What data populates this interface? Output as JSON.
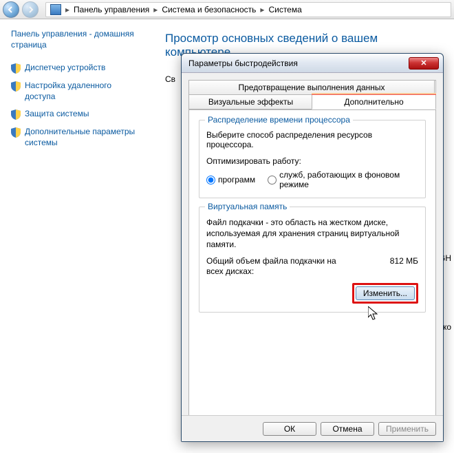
{
  "breadcrumb": {
    "items": [
      "Панель управления",
      "Система и безопасность",
      "Система"
    ]
  },
  "sidebar": {
    "home": "Панель управления - домашняя страница",
    "links": [
      "Диспетчер устройств",
      "Настройка удаленного доступа",
      "Защита системы",
      "Дополнительные параметры системы"
    ]
  },
  "page": {
    "title": "Просмотр основных сведений о вашем компьютере",
    "frag_left": "Св",
    "frag_gh": "GH",
    "frag_ko": "ко"
  },
  "dialog": {
    "title": "Параметры быстродействия",
    "tabs": {
      "dep": "Предотвращение выполнения данных",
      "visual": "Визуальные эффекты",
      "advanced": "Дополнительно"
    },
    "cpu": {
      "group_title": "Распределение времени процессора",
      "desc": "Выберите способ распределения ресурсов процессора.",
      "optimize_label": "Оптимизировать работу:",
      "opt_programs": "программ",
      "opt_services": "служб, работающих в фоновом режиме"
    },
    "vm": {
      "group_title": "Виртуальная память",
      "desc": "Файл подкачки - это область на жестком диске, используемая для хранения страниц виртуальной памяти.",
      "total_label": "Общий объем файла подкачки на всех дисках:",
      "total_value": "812 МБ",
      "change_btn": "Изменить..."
    },
    "buttons": {
      "ok": "ОК",
      "cancel": "Отмена",
      "apply": "Применить"
    }
  }
}
